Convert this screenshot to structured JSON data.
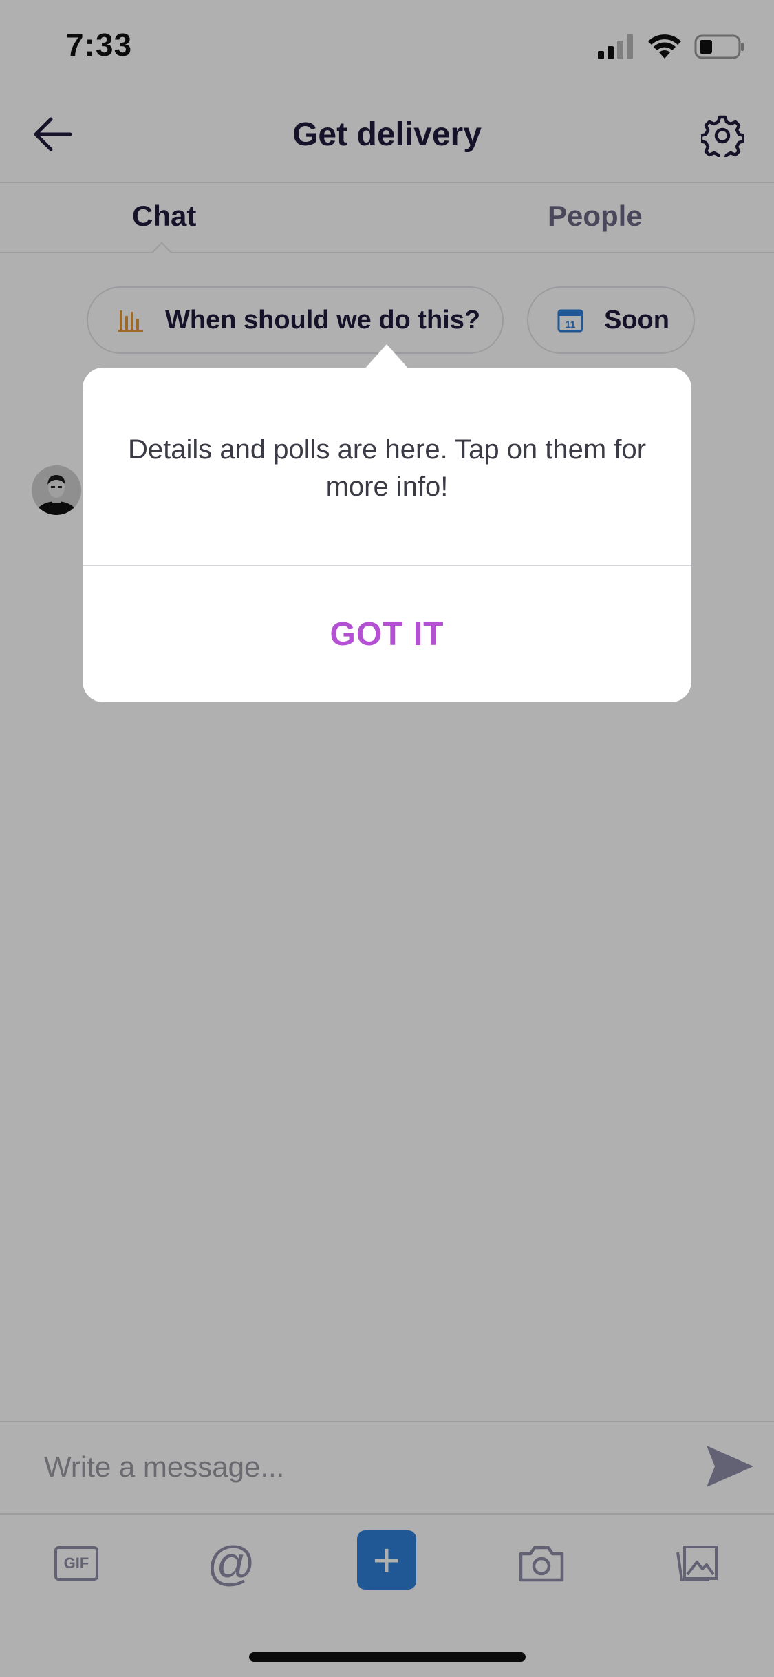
{
  "status_bar": {
    "time": "7:33"
  },
  "header": {
    "title": "Get delivery"
  },
  "tabs": [
    {
      "label": "Chat",
      "active": true
    },
    {
      "label": "People",
      "active": false
    }
  ],
  "pills": [
    {
      "label": "When should we do this?",
      "icon": "bar-chart-icon",
      "icon_color": "#e39a3b"
    },
    {
      "label": "Soon",
      "icon": "calendar-icon",
      "icon_day": "11",
      "icon_color": "#2f80d8"
    }
  ],
  "composer": {
    "placeholder": "Write a message..."
  },
  "toolbar": {
    "gif_label": "GIF",
    "at_label": "@",
    "plus_label": "+"
  },
  "tooltip": {
    "message": "Details and polls are here. Tap on them for more info!",
    "button_label": "GOT IT",
    "button_color": "#b451d2"
  },
  "colors": {
    "accent": "#2f80d8",
    "text": "#1f1b3d"
  }
}
